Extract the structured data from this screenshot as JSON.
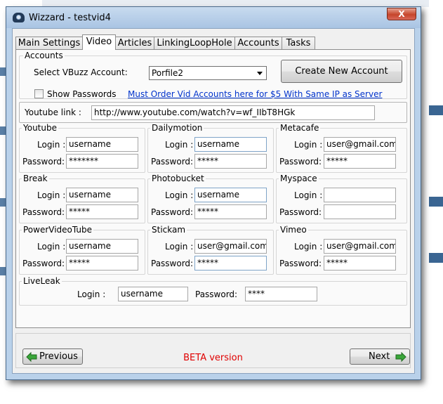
{
  "window": {
    "title": "Wizzard - testvid4",
    "close_label": "X"
  },
  "tabs": [
    "Main Settings",
    "Video",
    "Articles",
    "LinkingLoopHole",
    "Accounts",
    "Tasks"
  ],
  "accounts": {
    "group_label": "Accounts",
    "select_label": "Select VBuzz Account:",
    "selected_account": "Porfile2",
    "create_button": "Create New Account",
    "show_passwords_label": "Show Passwords",
    "order_link": "Must Order Vid Accounts here for $5 With Same IP as Server"
  },
  "youtube_link": {
    "label": "Youtube link :",
    "value": "http://www.youtube.com/watch?v=wf_IIbT8HGk"
  },
  "login_label": "Login :",
  "password_label": "Password:",
  "sites": [
    {
      "name": "Youtube",
      "login": "username",
      "password": "*******"
    },
    {
      "name": "Dailymotion",
      "login": "username",
      "password": "*****"
    },
    {
      "name": "Metacafe",
      "login": "user@gmail.com",
      "password": "*****"
    },
    {
      "name": "Break",
      "login": "username",
      "password": "*****"
    },
    {
      "name": "Photobucket",
      "login": "username",
      "password": "*****"
    },
    {
      "name": "Myspace",
      "login": "",
      "password": ""
    },
    {
      "name": "PowerVideoTube",
      "login": "username",
      "password": "*****"
    },
    {
      "name": "Stickam",
      "login": "user@gmail.com",
      "password": "*****"
    },
    {
      "name": "Vimeo",
      "login": "user@gmail.com",
      "password": "*****"
    }
  ],
  "liveleak": {
    "name": "LiveLeak",
    "login_label": "Login :",
    "login": "username",
    "password_label": "Password:",
    "password": "****"
  },
  "footer": {
    "previous_label": "Previous",
    "next_label": "Next",
    "status": "BETA version"
  }
}
